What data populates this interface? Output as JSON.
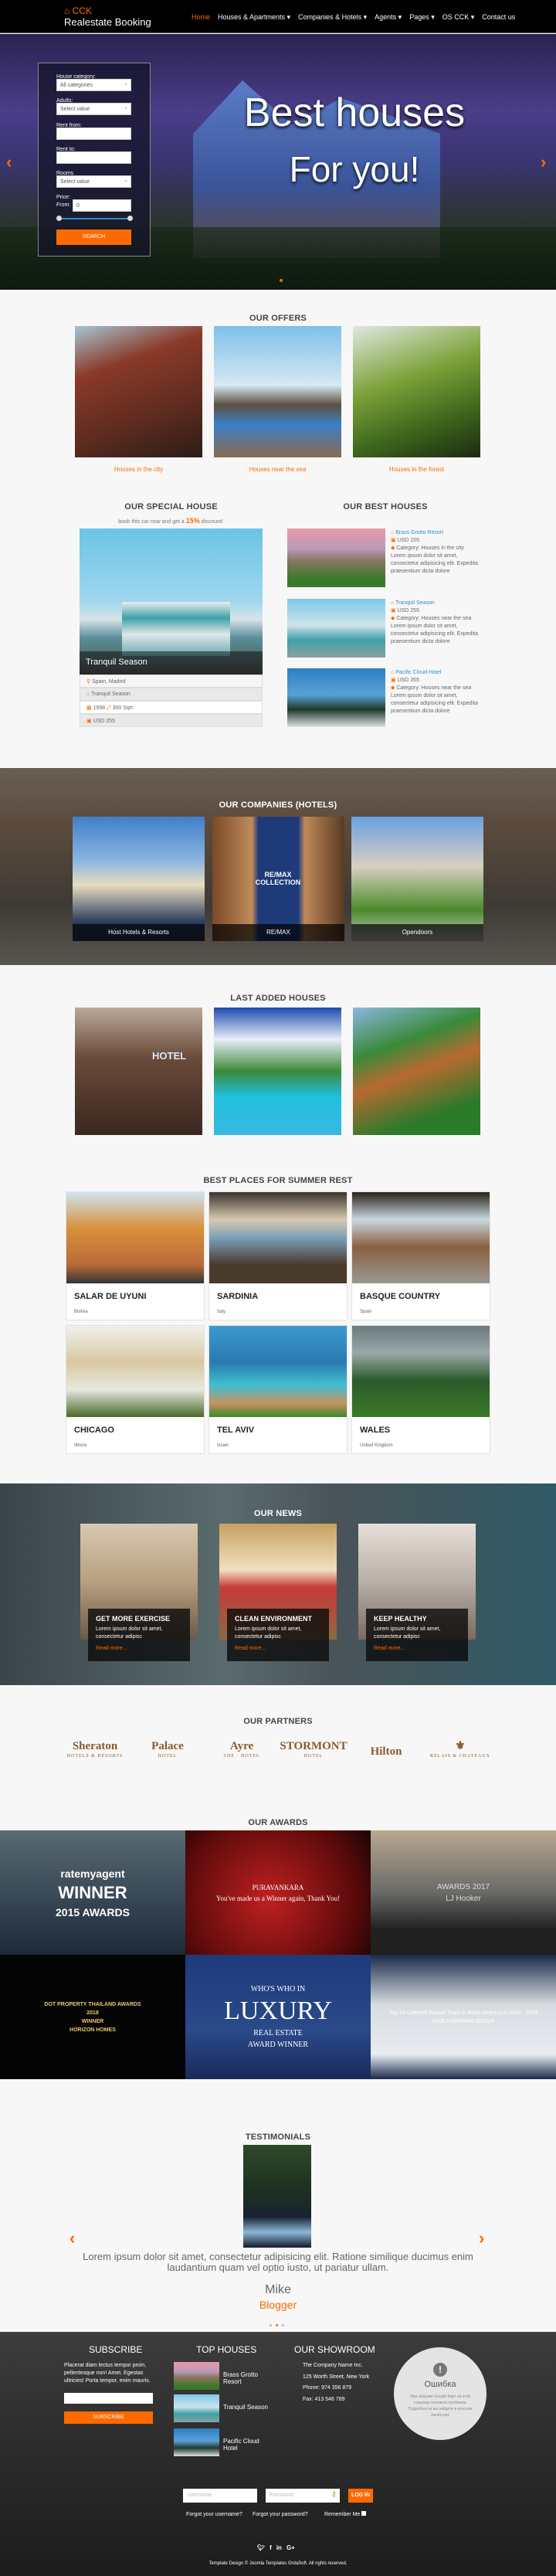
{
  "brand": {
    "top": "CCK",
    "name": "Realestate Booking",
    "accent": "#ff6a00"
  },
  "nav": [
    {
      "label": "Home",
      "active": true
    },
    {
      "label": "Houses & Apartments ▾"
    },
    {
      "label": "Companies & Hotels ▾"
    },
    {
      "label": "Agents ▾"
    },
    {
      "label": "Pages ▾"
    },
    {
      "label": "OS CCK ▾"
    },
    {
      "label": "Contact us"
    }
  ],
  "hero": {
    "line1": "Best houses",
    "line2": "For you!",
    "prev_icon": "chevron-left",
    "next_icon": "chevron-right"
  },
  "search": {
    "category_label": "House category:",
    "category_value": "All categories",
    "adults_label": "Adults:",
    "adults_value": "Select value",
    "rent_from_label": "Rent from:",
    "rent_from_value": "",
    "rent_to_label": "Rent to:",
    "rent_to_value": "",
    "rooms_label": "Rooms",
    "rooms_value": "Select value",
    "price_label": "Price:",
    "from_label": "From:",
    "from_value": "0",
    "price_range": [
      0,
      1
    ],
    "button": "SEARCH"
  },
  "offers": {
    "title": "OUR OFFERS",
    "items": [
      "Houses in the city",
      "Houses near the sea",
      "Houses in the forest"
    ]
  },
  "special": {
    "title": "OUR SPECIAL HOUSE",
    "subtitle_pre": "book this car now and get a ",
    "discount": "15%",
    "subtitle_post": " discount!",
    "caption": "Tranquil Season",
    "location": "Spain, Madrid",
    "name": "Tranquil Season",
    "year": "1998",
    "area": "300 Sqrt",
    "price": "USD 255"
  },
  "best_houses": {
    "title": "OUR BEST HOUSES",
    "items": [
      {
        "name": "Brass Grotto Resort",
        "price": "USD 155",
        "category": "Category: Houses in the city",
        "text": "Lorem ipsum dolor sit amet, consectetur adipisicing elit. Expedita praesentium dicta dolore"
      },
      {
        "name": "Tranquil Season",
        "price": "USD 255",
        "category": "Category: Houses near the sea",
        "text": "Lorem ipsum dolor sit amet, consectetur adipisicing elit. Expedita praesentium dicta dolore"
      },
      {
        "name": "Pacific Cloud Hotel",
        "price": "USD 355",
        "category": "Category: Houses near the sea",
        "text": "Lorem ipsum dolor sit amet, consectetur adipisicing elit. Expedita praesentium dicta dolore"
      }
    ]
  },
  "companies": {
    "title": "OUR COMPANIES (HOTELS)",
    "items": [
      "Host Hotels & Resorts",
      "RE/MAX",
      "Opendoors"
    ],
    "remax_logo": "RE/MAX COLLECTION"
  },
  "last_added": {
    "title": "LAST ADDED HOUSES",
    "hotel_sign": "HOTEL"
  },
  "places": {
    "title": "BEST PLACES FOR SUMMER REST",
    "items": [
      {
        "name": "SALAR DE UYUNI",
        "sub": "Bolivia"
      },
      {
        "name": "SARDINIA",
        "sub": "Italy"
      },
      {
        "name": "BASQUE COUNTRY",
        "sub": "Spain"
      },
      {
        "name": "CHICAGO",
        "sub": "Illinois"
      },
      {
        "name": "TEL AVIV",
        "sub": "Israel"
      },
      {
        "name": "WALES",
        "sub": "United Kingdom"
      }
    ]
  },
  "news": {
    "title": "OUR NEWS",
    "items": [
      {
        "title": "GET MORE EXERCISE",
        "text": "Lorem ipsum dolor sit amet, consectetur adipisc",
        "more": "Read more..."
      },
      {
        "title": "CLEAN ENVIRONMENT",
        "text": "Lorem ipsum dolor sit amet, consectetur adipisc",
        "more": "Read more..."
      },
      {
        "title": "KEEP HEALTHY",
        "text": "Lorem ipsum dolor sit amet, consectetur adipisc",
        "more": "Read more..."
      }
    ]
  },
  "partners": {
    "title": "OUR PARTNERS",
    "items": [
      {
        "name": "Sheraton",
        "sub": "HOTELS & RESORTS"
      },
      {
        "name": "Palace",
        "sub": "HOTEL"
      },
      {
        "name": "Ayre",
        "sub": "THE · HOTEL"
      },
      {
        "name": "STORMONT",
        "sub": "HOTEL"
      },
      {
        "name": "Hilton",
        "sub": ""
      },
      {
        "name": "⚜",
        "sub": "RELAIS & CHATEAUX"
      }
    ]
  },
  "awards": {
    "title": "OUR AWARDS",
    "items": [
      {
        "lines": [
          "ratemyagent",
          "WINNER",
          "2015 AWARDS"
        ]
      },
      {
        "lines": [
          "PURAVANKARA",
          "You've made us a Winner again, Thank You!"
        ]
      },
      {
        "lines": [
          "AWARDS 2017",
          "LJ Hooker"
        ]
      },
      {
        "lines": [
          "DOT PROPERTY THAILAND AWARDS",
          "2018",
          "WINNER",
          "HORIZON HOMES"
        ]
      },
      {
        "lines": [
          "WHO'S WHO IN",
          "LUXURY",
          "REAL ESTATE",
          "AWARD WINNER"
        ]
      },
      {
        "lines": [
          "Top 10 Coldwell Banker Team in North America in 2014 - 2018",
          "JANE HOFFMAN GROUP"
        ]
      }
    ]
  },
  "testimonials": {
    "title": "TESTIMONIALS",
    "text": "Lorem ipsum dolor sit amet, consectetur adipisicing elit. Ratione similique ducimus enim laudantium quam vel optio iusto, ut pariatur ullam.",
    "name": "Mike",
    "role": "Blogger",
    "slide": 2,
    "slides": 3
  },
  "footer": {
    "subscribe": {
      "title": "SUBSCRIBE",
      "text": "Placerat diam lectus tempor proin, pellentesque non! Amet. Egestas ultricies! Porta tempor, enim mauris.",
      "input_value": "",
      "button": "SUBSCRIBE"
    },
    "top_houses": {
      "title": "TOP HOUSES",
      "items": [
        "Brass Grotto Resort",
        "Tranquil Season",
        "Pacific Cloud Hotel"
      ]
    },
    "showroom": {
      "title": "OUR SHOWROOM",
      "lines": [
        "The Company Name Inc.",
        "125 Worth Street, New York",
        "Phone: 974 356 879",
        "Fax: 413 546 789"
      ],
      "map_error_title": "Ошибка",
      "map_error_text": "При загрузке Google Карт на этой странице возникла проблема. Подробности вы найдете в консоли JavaScript."
    },
    "login": {
      "username_placeholder": "Username",
      "password_placeholder": "Password",
      "button": "LOG IN",
      "forgot_username": "Forgot your username?",
      "forgot_password": "Forgot your password?",
      "remember": "Remember Me"
    },
    "social": [
      "twitter",
      "facebook",
      "linkedin",
      "google-plus"
    ],
    "copyright": "Template Design © Joomla Templates OrdaSoft. All rights reserved."
  }
}
